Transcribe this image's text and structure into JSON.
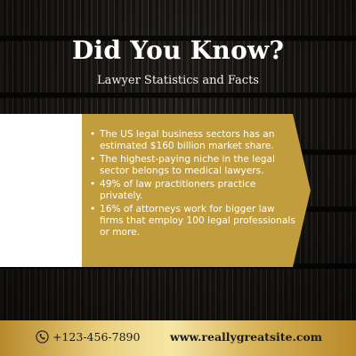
{
  "header": {
    "title": "Did You Know?",
    "subtitle": "Lawyer Statistics and Facts"
  },
  "facts": [
    "The US legal business sectors has an estimated $160 billion market share.",
    "The highest-paying niche in the legal sector belongs to medical lawyers.",
    "49% of law practitioners practice privately.",
    "16% of attorneys work for bigger law firms that employ 100 legal professionals or more."
  ],
  "footer": {
    "phone": "+123-456-7890",
    "website": "www.reallygreatsite.com",
    "phone_icon": "phone-icon"
  },
  "colors": {
    "gold": "#c29d3d",
    "footer_gold": "#e9cf7d",
    "text_light": "#ffffff"
  }
}
